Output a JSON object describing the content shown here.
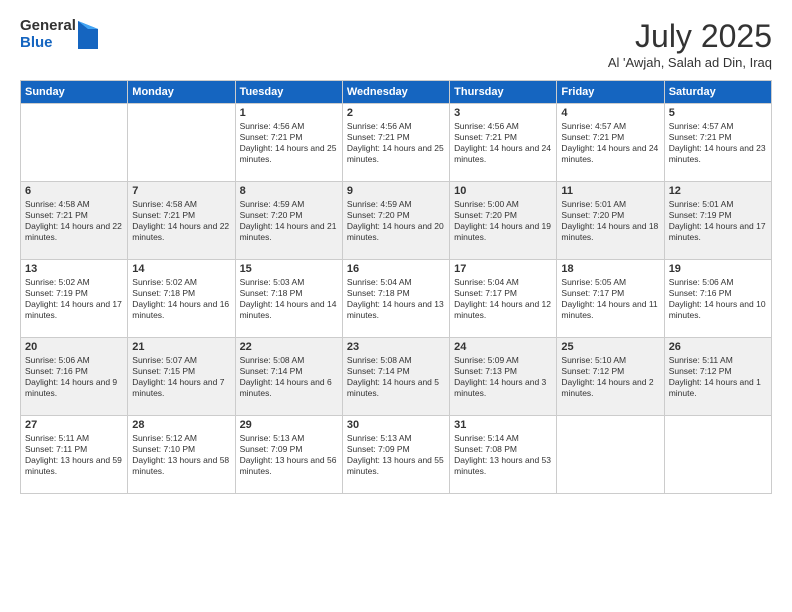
{
  "header": {
    "logo_general": "General",
    "logo_blue": "Blue",
    "title": "July 2025",
    "location": "Al 'Awjah, Salah ad Din, Iraq"
  },
  "days_of_week": [
    "Sunday",
    "Monday",
    "Tuesday",
    "Wednesday",
    "Thursday",
    "Friday",
    "Saturday"
  ],
  "weeks": [
    [
      {
        "day": "",
        "sunrise": "",
        "sunset": "",
        "daylight": ""
      },
      {
        "day": "",
        "sunrise": "",
        "sunset": "",
        "daylight": ""
      },
      {
        "day": "1",
        "sunrise": "Sunrise: 4:56 AM",
        "sunset": "Sunset: 7:21 PM",
        "daylight": "Daylight: 14 hours and 25 minutes."
      },
      {
        "day": "2",
        "sunrise": "Sunrise: 4:56 AM",
        "sunset": "Sunset: 7:21 PM",
        "daylight": "Daylight: 14 hours and 25 minutes."
      },
      {
        "day": "3",
        "sunrise": "Sunrise: 4:56 AM",
        "sunset": "Sunset: 7:21 PM",
        "daylight": "Daylight: 14 hours and 24 minutes."
      },
      {
        "day": "4",
        "sunrise": "Sunrise: 4:57 AM",
        "sunset": "Sunset: 7:21 PM",
        "daylight": "Daylight: 14 hours and 24 minutes."
      },
      {
        "day": "5",
        "sunrise": "Sunrise: 4:57 AM",
        "sunset": "Sunset: 7:21 PM",
        "daylight": "Daylight: 14 hours and 23 minutes."
      }
    ],
    [
      {
        "day": "6",
        "sunrise": "Sunrise: 4:58 AM",
        "sunset": "Sunset: 7:21 PM",
        "daylight": "Daylight: 14 hours and 22 minutes."
      },
      {
        "day": "7",
        "sunrise": "Sunrise: 4:58 AM",
        "sunset": "Sunset: 7:21 PM",
        "daylight": "Daylight: 14 hours and 22 minutes."
      },
      {
        "day": "8",
        "sunrise": "Sunrise: 4:59 AM",
        "sunset": "Sunset: 7:20 PM",
        "daylight": "Daylight: 14 hours and 21 minutes."
      },
      {
        "day": "9",
        "sunrise": "Sunrise: 4:59 AM",
        "sunset": "Sunset: 7:20 PM",
        "daylight": "Daylight: 14 hours and 20 minutes."
      },
      {
        "day": "10",
        "sunrise": "Sunrise: 5:00 AM",
        "sunset": "Sunset: 7:20 PM",
        "daylight": "Daylight: 14 hours and 19 minutes."
      },
      {
        "day": "11",
        "sunrise": "Sunrise: 5:01 AM",
        "sunset": "Sunset: 7:20 PM",
        "daylight": "Daylight: 14 hours and 18 minutes."
      },
      {
        "day": "12",
        "sunrise": "Sunrise: 5:01 AM",
        "sunset": "Sunset: 7:19 PM",
        "daylight": "Daylight: 14 hours and 17 minutes."
      }
    ],
    [
      {
        "day": "13",
        "sunrise": "Sunrise: 5:02 AM",
        "sunset": "Sunset: 7:19 PM",
        "daylight": "Daylight: 14 hours and 17 minutes."
      },
      {
        "day": "14",
        "sunrise": "Sunrise: 5:02 AM",
        "sunset": "Sunset: 7:18 PM",
        "daylight": "Daylight: 14 hours and 16 minutes."
      },
      {
        "day": "15",
        "sunrise": "Sunrise: 5:03 AM",
        "sunset": "Sunset: 7:18 PM",
        "daylight": "Daylight: 14 hours and 14 minutes."
      },
      {
        "day": "16",
        "sunrise": "Sunrise: 5:04 AM",
        "sunset": "Sunset: 7:18 PM",
        "daylight": "Daylight: 14 hours and 13 minutes."
      },
      {
        "day": "17",
        "sunrise": "Sunrise: 5:04 AM",
        "sunset": "Sunset: 7:17 PM",
        "daylight": "Daylight: 14 hours and 12 minutes."
      },
      {
        "day": "18",
        "sunrise": "Sunrise: 5:05 AM",
        "sunset": "Sunset: 7:17 PM",
        "daylight": "Daylight: 14 hours and 11 minutes."
      },
      {
        "day": "19",
        "sunrise": "Sunrise: 5:06 AM",
        "sunset": "Sunset: 7:16 PM",
        "daylight": "Daylight: 14 hours and 10 minutes."
      }
    ],
    [
      {
        "day": "20",
        "sunrise": "Sunrise: 5:06 AM",
        "sunset": "Sunset: 7:16 PM",
        "daylight": "Daylight: 14 hours and 9 minutes."
      },
      {
        "day": "21",
        "sunrise": "Sunrise: 5:07 AM",
        "sunset": "Sunset: 7:15 PM",
        "daylight": "Daylight: 14 hours and 7 minutes."
      },
      {
        "day": "22",
        "sunrise": "Sunrise: 5:08 AM",
        "sunset": "Sunset: 7:14 PM",
        "daylight": "Daylight: 14 hours and 6 minutes."
      },
      {
        "day": "23",
        "sunrise": "Sunrise: 5:08 AM",
        "sunset": "Sunset: 7:14 PM",
        "daylight": "Daylight: 14 hours and 5 minutes."
      },
      {
        "day": "24",
        "sunrise": "Sunrise: 5:09 AM",
        "sunset": "Sunset: 7:13 PM",
        "daylight": "Daylight: 14 hours and 3 minutes."
      },
      {
        "day": "25",
        "sunrise": "Sunrise: 5:10 AM",
        "sunset": "Sunset: 7:12 PM",
        "daylight": "Daylight: 14 hours and 2 minutes."
      },
      {
        "day": "26",
        "sunrise": "Sunrise: 5:11 AM",
        "sunset": "Sunset: 7:12 PM",
        "daylight": "Daylight: 14 hours and 1 minute."
      }
    ],
    [
      {
        "day": "27",
        "sunrise": "Sunrise: 5:11 AM",
        "sunset": "Sunset: 7:11 PM",
        "daylight": "Daylight: 13 hours and 59 minutes."
      },
      {
        "day": "28",
        "sunrise": "Sunrise: 5:12 AM",
        "sunset": "Sunset: 7:10 PM",
        "daylight": "Daylight: 13 hours and 58 minutes."
      },
      {
        "day": "29",
        "sunrise": "Sunrise: 5:13 AM",
        "sunset": "Sunset: 7:09 PM",
        "daylight": "Daylight: 13 hours and 56 minutes."
      },
      {
        "day": "30",
        "sunrise": "Sunrise: 5:13 AM",
        "sunset": "Sunset: 7:09 PM",
        "daylight": "Daylight: 13 hours and 55 minutes."
      },
      {
        "day": "31",
        "sunrise": "Sunrise: 5:14 AM",
        "sunset": "Sunset: 7:08 PM",
        "daylight": "Daylight: 13 hours and 53 minutes."
      },
      {
        "day": "",
        "sunrise": "",
        "sunset": "",
        "daylight": ""
      },
      {
        "day": "",
        "sunrise": "",
        "sunset": "",
        "daylight": ""
      }
    ]
  ]
}
